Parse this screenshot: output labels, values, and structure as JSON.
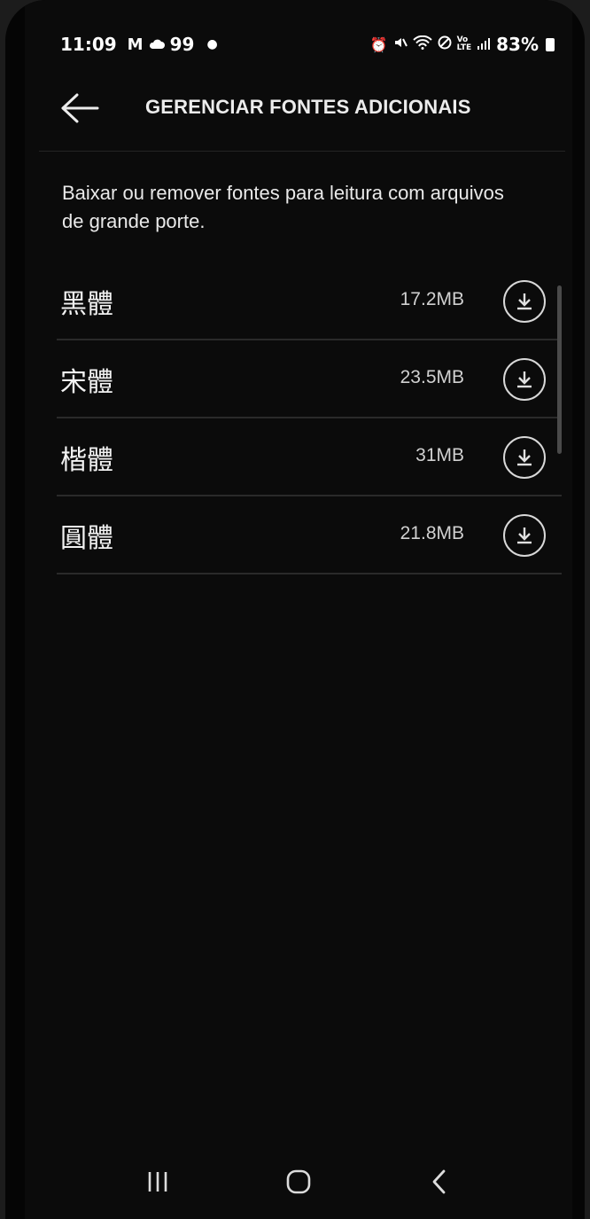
{
  "status_bar": {
    "time": "11:09",
    "notification_count": "99",
    "battery": "83%",
    "icons_left": [
      "gmail-icon",
      "cloud-icon"
    ],
    "icons_right": [
      "alarm-icon",
      "mute-icon",
      "wifi-icon",
      "dnd-icon",
      "volte-icon",
      "signal-icon",
      "battery-icon"
    ]
  },
  "header": {
    "title": "GERENCIAR FONTES ADICIONAIS",
    "back_icon": "arrow-left-icon"
  },
  "description": "Baixar ou remover fontes para leitura com arquivos de grande porte.",
  "fonts": [
    {
      "name": "黑體",
      "size": "17.2MB",
      "action_icon": "download-icon"
    },
    {
      "name": "宋體",
      "size": "23.5MB",
      "action_icon": "download-icon"
    },
    {
      "name": "楷體",
      "size": "31MB",
      "action_icon": "download-icon"
    },
    {
      "name": "圓體",
      "size": "21.8MB",
      "action_icon": "download-icon"
    }
  ],
  "nav_bar": {
    "icons": [
      "recent-apps-icon",
      "home-icon",
      "back-icon"
    ]
  },
  "colors": {
    "background": "#0b0b0b",
    "text": "#e6e6e6",
    "divider": "#2a2a2a"
  }
}
